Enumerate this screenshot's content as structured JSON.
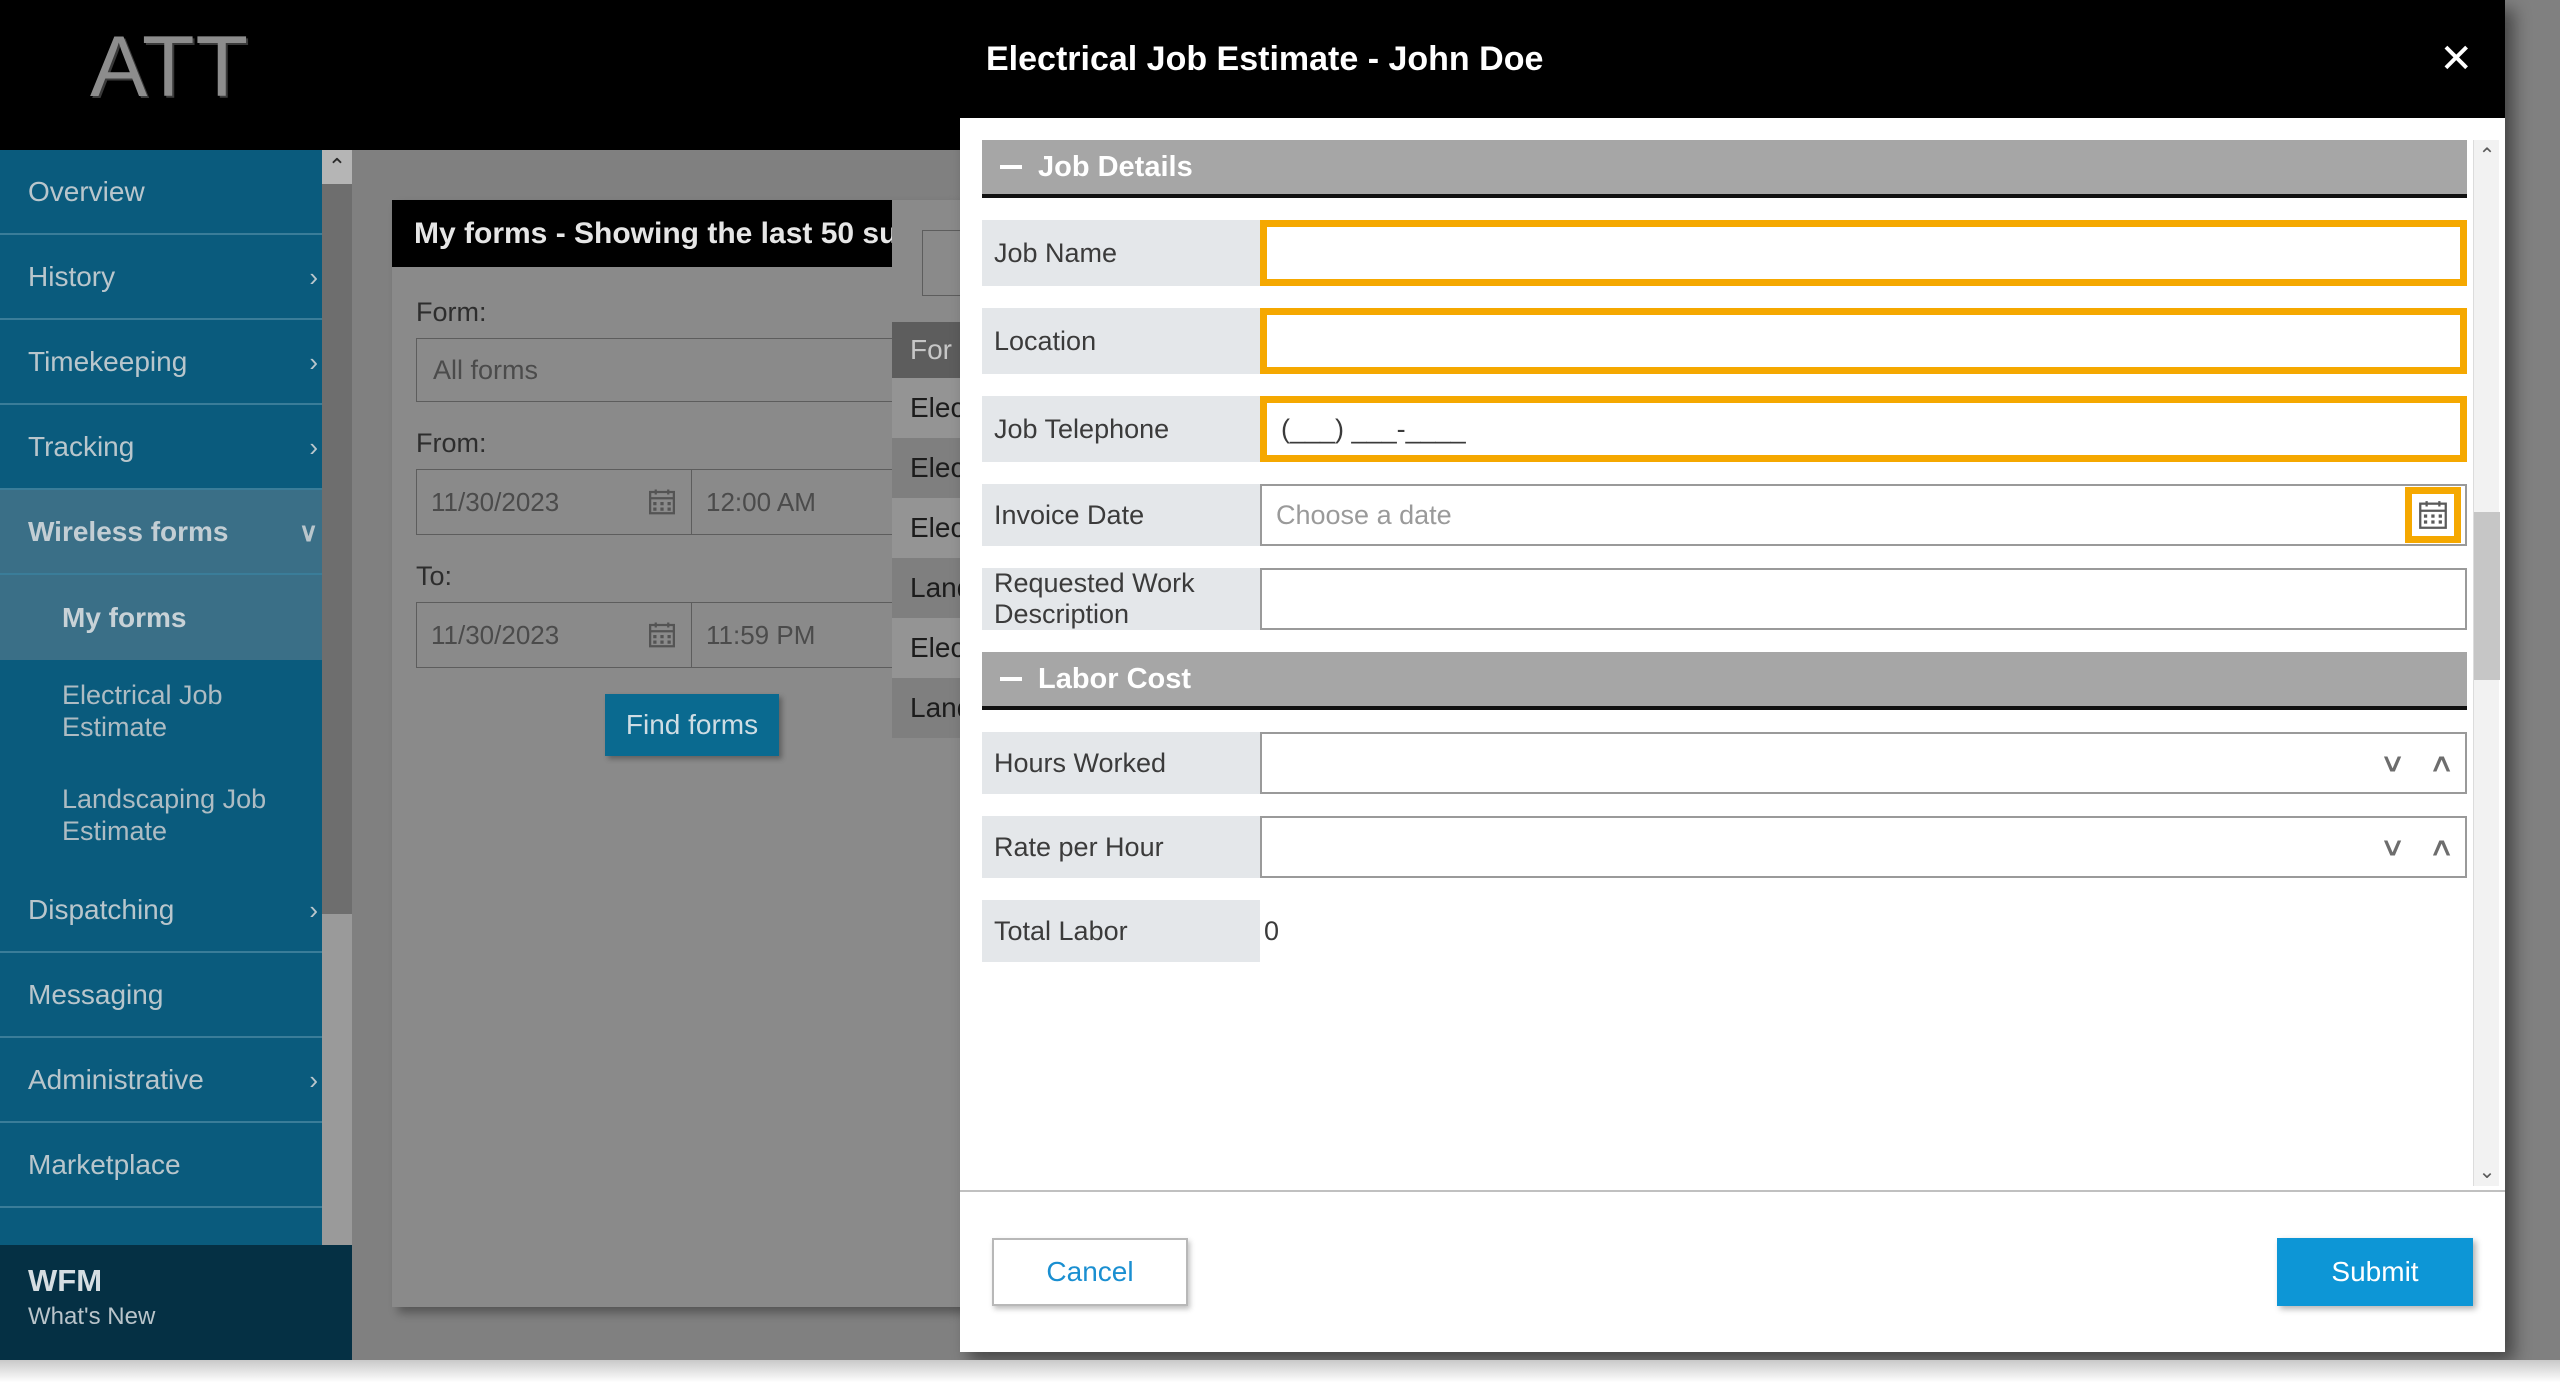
{
  "brand": {
    "logo_text": "ATT"
  },
  "sidebar": {
    "items": [
      {
        "label": "Overview",
        "caret": "",
        "type": "top"
      },
      {
        "label": "History",
        "caret": "›",
        "type": "top"
      },
      {
        "label": "Timekeeping",
        "caret": "›",
        "type": "top"
      },
      {
        "label": "Tracking",
        "caret": "›",
        "type": "top"
      },
      {
        "label": "Wireless forms",
        "caret": "∨",
        "type": "expanded"
      },
      {
        "label": "My forms",
        "caret": "",
        "type": "subactive"
      },
      {
        "label": "Electrical Job Estimate",
        "caret": "",
        "type": "sub"
      },
      {
        "label": "Landscaping Job Estimate",
        "caret": "",
        "type": "sub"
      },
      {
        "label": "Dispatching",
        "caret": "›",
        "type": "top"
      },
      {
        "label": "Messaging",
        "caret": "",
        "type": "top"
      },
      {
        "label": "Administrative",
        "caret": "›",
        "type": "top"
      },
      {
        "label": "Marketplace",
        "caret": "",
        "type": "top"
      }
    ],
    "scroll_up_icon": "⌃",
    "scroll_down_icon": "⌄",
    "footer": {
      "title": "WFM",
      "subtitle": "What's New"
    }
  },
  "myforms": {
    "title": "My forms - Showing the last 50 su",
    "form_label": "Form:",
    "form_value": "All forms",
    "from_label": "From:",
    "from_date": "11/30/2023",
    "from_time": "12:00 AM",
    "to_label": "To:",
    "to_date": "11/30/2023",
    "to_time": "11:59 PM",
    "find_button": "Find forms"
  },
  "results": {
    "search_icon": "search-icon",
    "header": "For",
    "rows": [
      "Elec",
      "Elec",
      "Elec",
      "Land",
      "Elec",
      "Land"
    ]
  },
  "modal": {
    "title": "Electrical Job Estimate - John Doe",
    "close_icon": "✕",
    "sections": [
      {
        "name": "Job Details",
        "collapse_icon": "minus-icon",
        "fields": [
          {
            "label": "Job Name",
            "type": "text",
            "value": "",
            "placeholder": "",
            "highlight": true
          },
          {
            "label": "Location",
            "type": "text",
            "value": "",
            "placeholder": "",
            "highlight": true
          },
          {
            "label": "Job Telephone",
            "type": "text",
            "value": "(___) ___-____",
            "placeholder": "",
            "highlight": true
          },
          {
            "label": "Invoice Date",
            "type": "date",
            "value": "",
            "placeholder": "Choose a date",
            "highlight": false,
            "button_highlight": true
          },
          {
            "label": "Requested Work Description",
            "type": "text",
            "value": "",
            "placeholder": "",
            "highlight": false
          }
        ]
      },
      {
        "name": "Labor Cost",
        "collapse_icon": "minus-icon",
        "fields": [
          {
            "label": "Hours Worked",
            "type": "spinner",
            "value": "",
            "placeholder": "",
            "highlight": false
          },
          {
            "label": "Rate per Hour",
            "type": "spinner",
            "value": "",
            "placeholder": "",
            "highlight": false
          },
          {
            "label": "Total Labor",
            "type": "static",
            "value": "0",
            "placeholder": "",
            "highlight": false
          }
        ]
      }
    ],
    "spinner_down_icon": "∨",
    "spinner_up_icon": "∧",
    "scroll_up_icon": "⌃",
    "scroll_down_icon": "⌄",
    "cancel_label": "Cancel",
    "submit_label": "Submit"
  },
  "colors": {
    "sidebar_bg": "#0a5b7d",
    "accent_orange": "#f5a800",
    "submit_blue": "#0d96d6",
    "link_blue": "#1a8fd1",
    "section_gray": "#a6a6a6"
  }
}
